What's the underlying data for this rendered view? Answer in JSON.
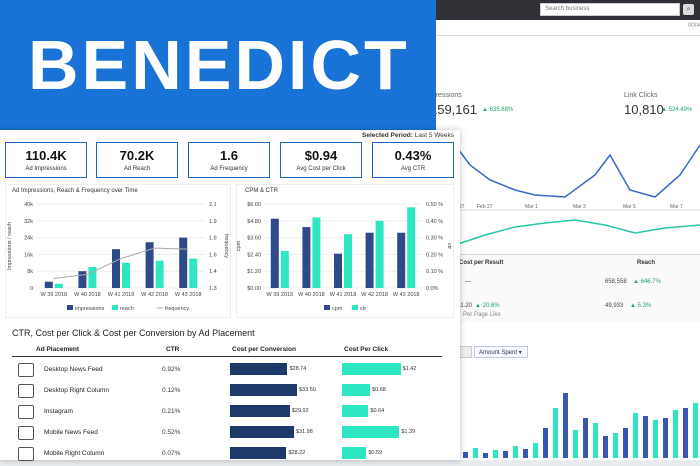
{
  "banner": {
    "title": "BENEDICT"
  },
  "header": {
    "period_label": "Selected Period:",
    "period_value": "Last 5 Weeks"
  },
  "kpis": [
    {
      "value": "110.4K",
      "label": "Ad Impressions"
    },
    {
      "value": "70.2K",
      "label": "Ad Reach"
    },
    {
      "value": "1.6",
      "label": "Ad Frequency"
    },
    {
      "value": "$0.94",
      "label": "Avg Cost per Click"
    },
    {
      "value": "0.43%",
      "label": "Avg CTR"
    }
  ],
  "background": {
    "search_placeholder": "Search business",
    "nav_right": "0004",
    "impressions_label": "mpressions",
    "impressions_value": "159,161",
    "impressions_delta": "▲ 635.88%",
    "link_clicks_label": "Link Clicks",
    "link_clicks_value": "10,810",
    "link_clicks_delta": "▲ 524.49%",
    "line_x_labels": [
      "27",
      "Feb 27",
      "Mar 1",
      "Mar 3",
      "Mar 5",
      "Mar 7"
    ],
    "table_headers": [
      "Cost per Result",
      "Reach"
    ],
    "table_row1": [
      "—",
      "658,558",
      "▲ 646.7%"
    ],
    "table_row2": [
      "$1.20",
      "▲ 20.6%",
      "49,933",
      "▲ 5.3%"
    ],
    "table_row2_sub": "Per Page Like",
    "amount_spent_label": "Amount Spent ▾"
  },
  "colors": {
    "impressions": "#2f4a8a",
    "reach": "#2ee6c1",
    "kpi_border": "#1e66c6",
    "banner": "#1973d6"
  },
  "chart_data": [
    {
      "type": "bar",
      "title": "Ad Impressions, Reach & Frequency over Time",
      "categories": [
        "W 39 2018",
        "W 40 2018",
        "W 41 2018",
        "W 42 2018",
        "W 43 2018"
      ],
      "series": [
        {
          "name": "impressions",
          "type": "bar",
          "values": [
            3000,
            8000,
            18500,
            21800,
            24000
          ]
        },
        {
          "name": "reach",
          "type": "bar",
          "values": [
            2000,
            10000,
            12000,
            13000,
            14000
          ]
        },
        {
          "name": "frequency",
          "type": "line",
          "values": [
            1.39,
            1.43,
            1.58,
            1.68,
            1.67
          ]
        }
      ],
      "ylabel": "Impressions / reach",
      "y2label": "frequency",
      "ylim": [
        0,
        40000
      ],
      "y2lim": [
        1.3,
        2.1
      ],
      "yticks": [
        "0",
        "8k",
        "16k",
        "24k",
        "32k",
        "40k"
      ],
      "y2ticks": [
        "1.3",
        "1.4",
        "1.6",
        "1.8",
        "1.9",
        "2.1"
      ]
    },
    {
      "type": "bar",
      "title": "CPM & CTR",
      "categories": [
        "W 39 2018",
        "W 40 2018",
        "W 41 2018",
        "W 42 2018",
        "W 43 2018"
      ],
      "series": [
        {
          "name": "cpm",
          "values": [
            4.95,
            4.35,
            2.45,
            3.95,
            3.95
          ]
        },
        {
          "name": "ctr",
          "values": [
            0.22,
            0.42,
            0.32,
            0.4,
            0.48
          ]
        }
      ],
      "ylabel": "cpm",
      "y2label": "ctr",
      "ylim": [
        0,
        6
      ],
      "y2lim": [
        0,
        0.5
      ],
      "yticks": [
        "$0.00",
        "$1.20",
        "$2.40",
        "$3.60",
        "$4.80",
        "$6.00"
      ],
      "y2ticks": [
        "0.0%",
        "0.10 %",
        "0.20 %",
        "0.30 %",
        "0.40 %",
        "0.50 %"
      ]
    }
  ],
  "placements": {
    "title": "CTR, Cost per Click & Cost per Conversion by Ad Placement",
    "headers": [
      "Ad Placement",
      "CTR",
      "Cost per Conversion",
      "Cost Per Click"
    ],
    "rows": [
      {
        "name": "Desktop News Feed",
        "ctr": "0.92%",
        "conv": "$28.74",
        "conv_val": 28.74,
        "cpc": "$1.42",
        "cpc_val": 1.42,
        "icon": "desktop-icon"
      },
      {
        "name": "Desktop Right Column",
        "ctr": "0.12%",
        "conv": "$33.50",
        "conv_val": 33.5,
        "cpc": "$0.68",
        "cpc_val": 0.68,
        "icon": "desktop-icon"
      },
      {
        "name": "Instagram",
        "ctr": "0.21%",
        "conv": "$29.92",
        "conv_val": 29.92,
        "cpc": "$0.64",
        "cpc_val": 0.64,
        "icon": "instagram-icon"
      },
      {
        "name": "Mobile News Feed",
        "ctr": "0.52%",
        "conv": "$31.98",
        "conv_val": 31.98,
        "cpc": "$1.39",
        "cpc_val": 1.39,
        "icon": "mobile-icon"
      },
      {
        "name": "Mobile Right Column",
        "ctr": "0.07%",
        "conv": "$28.22",
        "conv_val": 28.22,
        "cpc": "$0.59",
        "cpc_val": 0.59,
        "icon": "mobile-icon"
      }
    ]
  }
}
